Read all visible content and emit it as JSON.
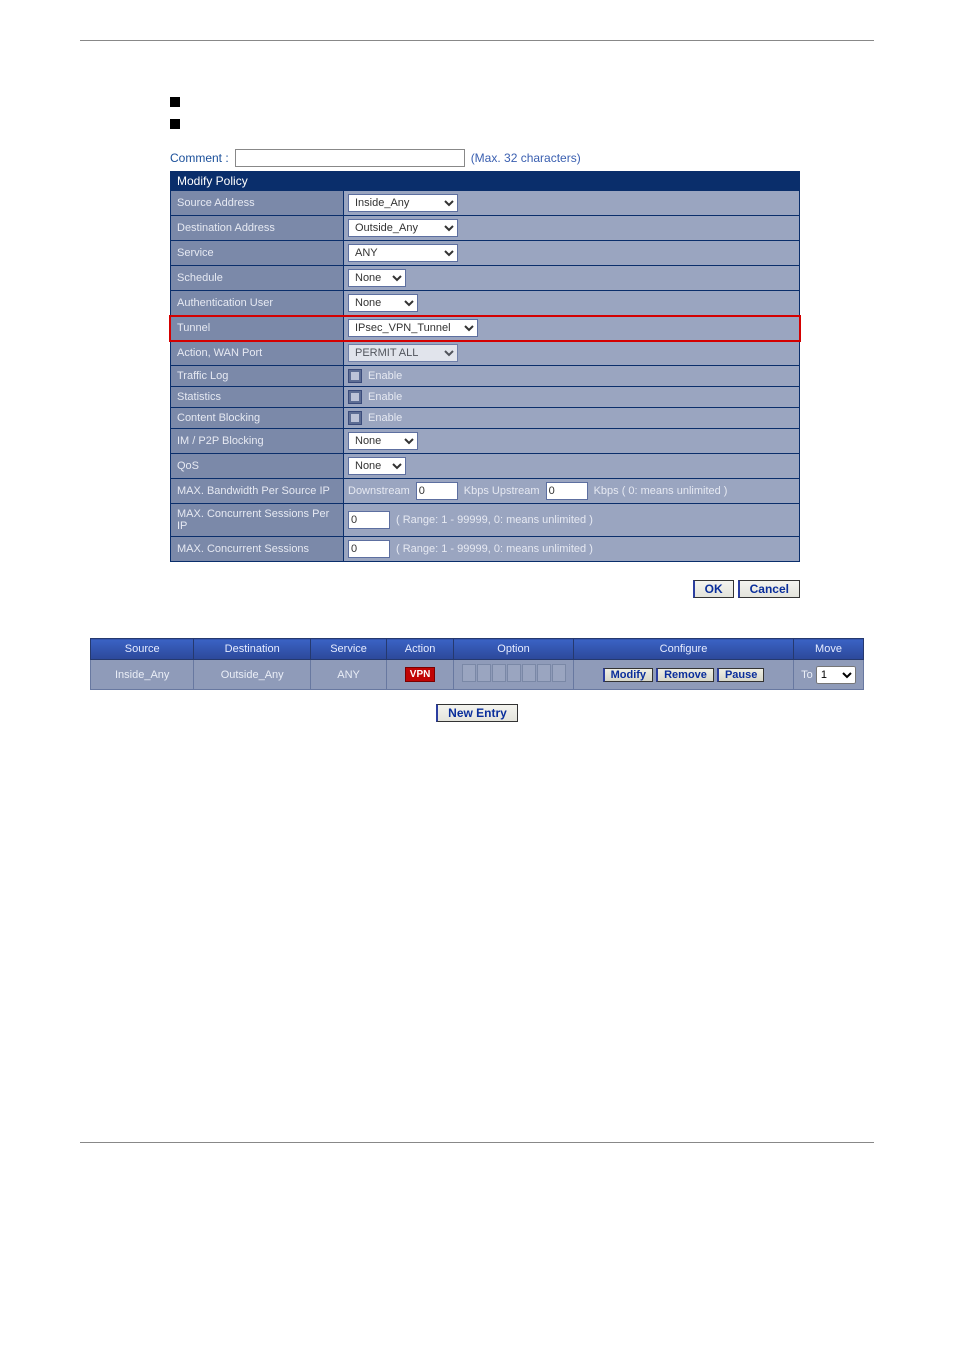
{
  "comment": {
    "label": "Comment :",
    "value": "",
    "max": "(Max. 32 characters)"
  },
  "section": "Modify Policy",
  "rows": {
    "source_address": {
      "label": "Source Address",
      "value": "Inside_Any"
    },
    "dest_address": {
      "label": "Destination Address",
      "value": "Outside_Any"
    },
    "service": {
      "label": "Service",
      "value": "ANY"
    },
    "schedule": {
      "label": "Schedule",
      "value": "None"
    },
    "auth_user": {
      "label": "Authentication User",
      "value": "None"
    },
    "tunnel": {
      "label": "Tunnel",
      "value": "IPsec_VPN_Tunnel"
    },
    "action": {
      "label": "Action, WAN Port",
      "value": "PERMIT ALL"
    },
    "traffic_log": {
      "label": "Traffic Log",
      "text": "Enable"
    },
    "statistics": {
      "label": "Statistics",
      "text": "Enable"
    },
    "content_block": {
      "label": "Content Blocking",
      "text": "Enable"
    },
    "im_p2p": {
      "label": "IM / P2P Blocking",
      "value": "None"
    },
    "qos": {
      "label": "QoS",
      "value": "None"
    },
    "max_bw": {
      "label": "MAX. Bandwidth Per Source IP",
      "down_label": "Downstream",
      "down_val": "0",
      "up_label": "Kbps Upstream",
      "up_val": "0",
      "hint": "Kbps ( 0: means unlimited )"
    },
    "max_sess_ip": {
      "label": "MAX. Concurrent Sessions Per IP",
      "val": "0",
      "hint": "( Range: 1 - 99999, 0: means unlimited )"
    },
    "max_sess": {
      "label": "MAX. Concurrent Sessions",
      "val": "0",
      "hint": "( Range: 1 - 99999, 0: means unlimited )"
    }
  },
  "buttons": {
    "ok": "OK",
    "cancel": "Cancel",
    "new_entry": "New Entry"
  },
  "table": {
    "headers": {
      "source": "Source",
      "destination": "Destination",
      "service": "Service",
      "action": "Action",
      "option": "Option",
      "configure": "Configure",
      "move": "Move"
    },
    "row": {
      "source": "Inside_Any",
      "destination": "Outside_Any",
      "service": "ANY",
      "action": "VPN",
      "cfg_modify": "Modify",
      "cfg_remove": "Remove",
      "cfg_pause": "Pause",
      "move_to": "To",
      "move_val": "1"
    }
  }
}
